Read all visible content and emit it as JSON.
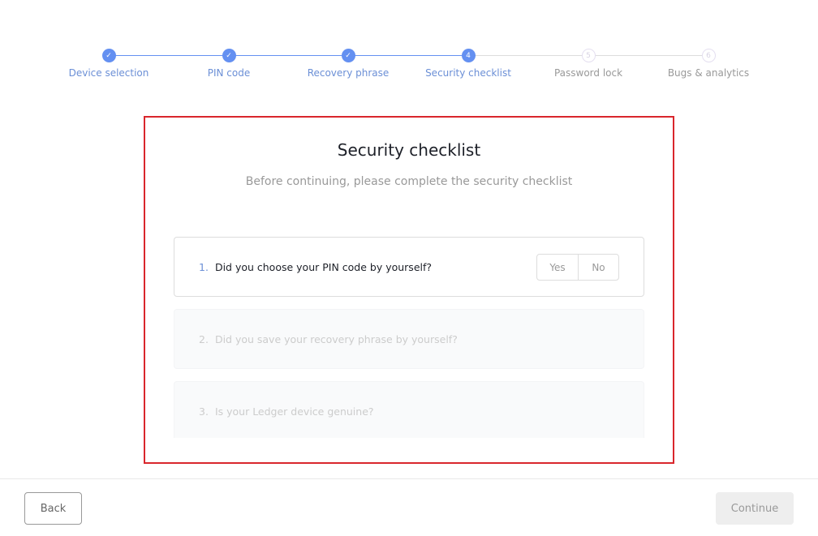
{
  "stepper": {
    "steps": [
      {
        "label": "Device selection",
        "state": "done",
        "marker": "✓"
      },
      {
        "label": "PIN code",
        "state": "done",
        "marker": "✓"
      },
      {
        "label": "Recovery phrase",
        "state": "done",
        "marker": "✓"
      },
      {
        "label": "Security checklist",
        "state": "active",
        "marker": "4"
      },
      {
        "label": "Password lock",
        "state": "todo",
        "marker": "5"
      },
      {
        "label": "Bugs & analytics",
        "state": "todo",
        "marker": "6"
      }
    ]
  },
  "main": {
    "title": "Security checklist",
    "subtitle": "Before continuing, please complete the security checklist",
    "questions": [
      {
        "num": "1.",
        "text": "Did you choose your PIN code by yourself?",
        "yes": "Yes",
        "no": "No"
      },
      {
        "num": "2.",
        "text": "Did you save your recovery phrase by yourself?"
      },
      {
        "num": "3.",
        "text": "Is your Ledger device genuine?"
      }
    ]
  },
  "footer": {
    "back": "Back",
    "continue": "Continue"
  },
  "colors": {
    "accent": "#6490f1",
    "highlight": "#d9262c"
  }
}
